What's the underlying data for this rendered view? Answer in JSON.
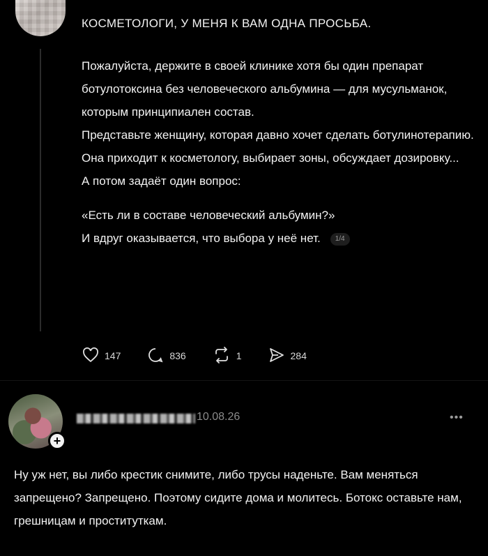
{
  "post": {
    "title": "КОСМЕТОЛОГИ, У МЕНЯ К ВАМ ОДНА ПРОСЬБА.",
    "paragraphs": [
      "Пожалуйста, держите в своей клинике хотя бы один препарат ботулотоксина без человеческого альбумина — для мусульманок, которым принципиален состав.",
      "Представьте женщину, которая давно хочет сделать ботулинотерапию.",
      "Она приходит к косметологу, выбирает зоны, обсуждает дозировку...",
      "А потом задаёт один вопрос:",
      "«Есть ли в составе человеческий альбумин?»"
    ],
    "last_line": "И вдруг оказывается, что выбора у неё нет.",
    "page_counter": "1/4",
    "stats": {
      "likes": "147",
      "comments": "836",
      "reposts": "1",
      "shares": "284"
    }
  },
  "reply": {
    "date": "10.08.26",
    "more": "•••",
    "text": "Ну уж нет, вы либо крестик снимите, либо трусы наденьте. Вам меняться запрещено? Запрещено. Поэтому сидите дома и молитесь. Ботокс оставьте нам, грешницам и проституткам.",
    "add_badge": "+"
  },
  "icons": [
    "heart-icon",
    "comment-icon",
    "repost-icon",
    "share-icon",
    "plus-icon"
  ]
}
